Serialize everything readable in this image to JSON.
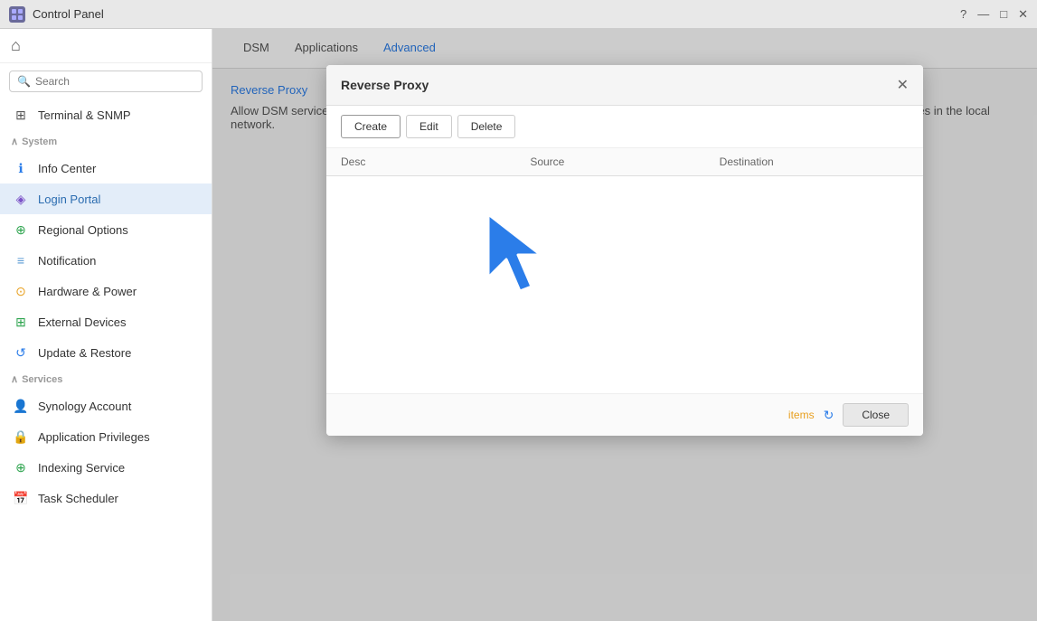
{
  "titlebar": {
    "icon_label": "CP",
    "title": "Control Panel",
    "help_label": "?",
    "minimize_label": "—",
    "maximize_label": "□",
    "close_label": "✕"
  },
  "sidebar": {
    "search_placeholder": "Search",
    "home_icon": "⌂",
    "sections": [
      {
        "name": "system",
        "label": "System",
        "collapsible": true,
        "items": [
          {
            "id": "terminal",
            "label": "Terminal & SNMP",
            "icon": "⊞",
            "icon_color": "#555",
            "active": false
          },
          {
            "id": "info-center",
            "label": "Info Center",
            "icon": "ℹ",
            "icon_color": "#2b7de9",
            "active": false
          },
          {
            "id": "login-portal",
            "label": "Login Portal",
            "icon": "◈",
            "icon_color": "#7b52c7",
            "active": true
          },
          {
            "id": "regional-options",
            "label": "Regional Options",
            "icon": "⊕",
            "icon_color": "#2da44e",
            "active": false
          },
          {
            "id": "notification",
            "label": "Notification",
            "icon": "≡",
            "icon_color": "#5b9bd5",
            "active": false
          },
          {
            "id": "hardware-power",
            "label": "Hardware & Power",
            "icon": "⊙",
            "icon_color": "#e8a020",
            "active": false
          },
          {
            "id": "external-devices",
            "label": "External Devices",
            "icon": "⊞",
            "icon_color": "#2da44e",
            "active": false
          },
          {
            "id": "update-restore",
            "label": "Update & Restore",
            "icon": "↺",
            "icon_color": "#2b7de9",
            "active": false
          }
        ]
      },
      {
        "name": "services",
        "label": "Services",
        "collapsible": true,
        "items": [
          {
            "id": "synology-account",
            "label": "Synology Account",
            "icon": "👤",
            "icon_color": "#2b7de9",
            "active": false
          },
          {
            "id": "application-privileges",
            "label": "Application Privileges",
            "icon": "🔒",
            "icon_color": "#e8a020",
            "active": false
          },
          {
            "id": "indexing-service",
            "label": "Indexing Service",
            "icon": "⊕",
            "icon_color": "#2da44e",
            "active": false
          },
          {
            "id": "task-scheduler",
            "label": "Task Scheduler",
            "icon": "📅",
            "icon_color": "#e74c3c",
            "active": false
          }
        ]
      }
    ]
  },
  "tabs": {
    "items": [
      {
        "id": "dsm",
        "label": "DSM",
        "active": false
      },
      {
        "id": "applications",
        "label": "Applications",
        "active": false
      },
      {
        "id": "advanced",
        "label": "Advanced",
        "active": true
      }
    ]
  },
  "breadcrumb": "Reverse Proxy",
  "description": "evices in the local network.",
  "dialog": {
    "title": "Reverse Proxy",
    "close_label": "✕",
    "toolbar": {
      "create_label": "Create",
      "edit_label": "Edit",
      "delete_label": "Delete"
    },
    "table": {
      "columns": [
        {
          "id": "desc",
          "label": "Desc"
        },
        {
          "id": "source",
          "label": "Source"
        },
        {
          "id": "destination",
          "label": "Destination"
        }
      ]
    },
    "footer": {
      "items_label": "items",
      "refresh_icon": "↻",
      "close_label": "Close"
    }
  }
}
